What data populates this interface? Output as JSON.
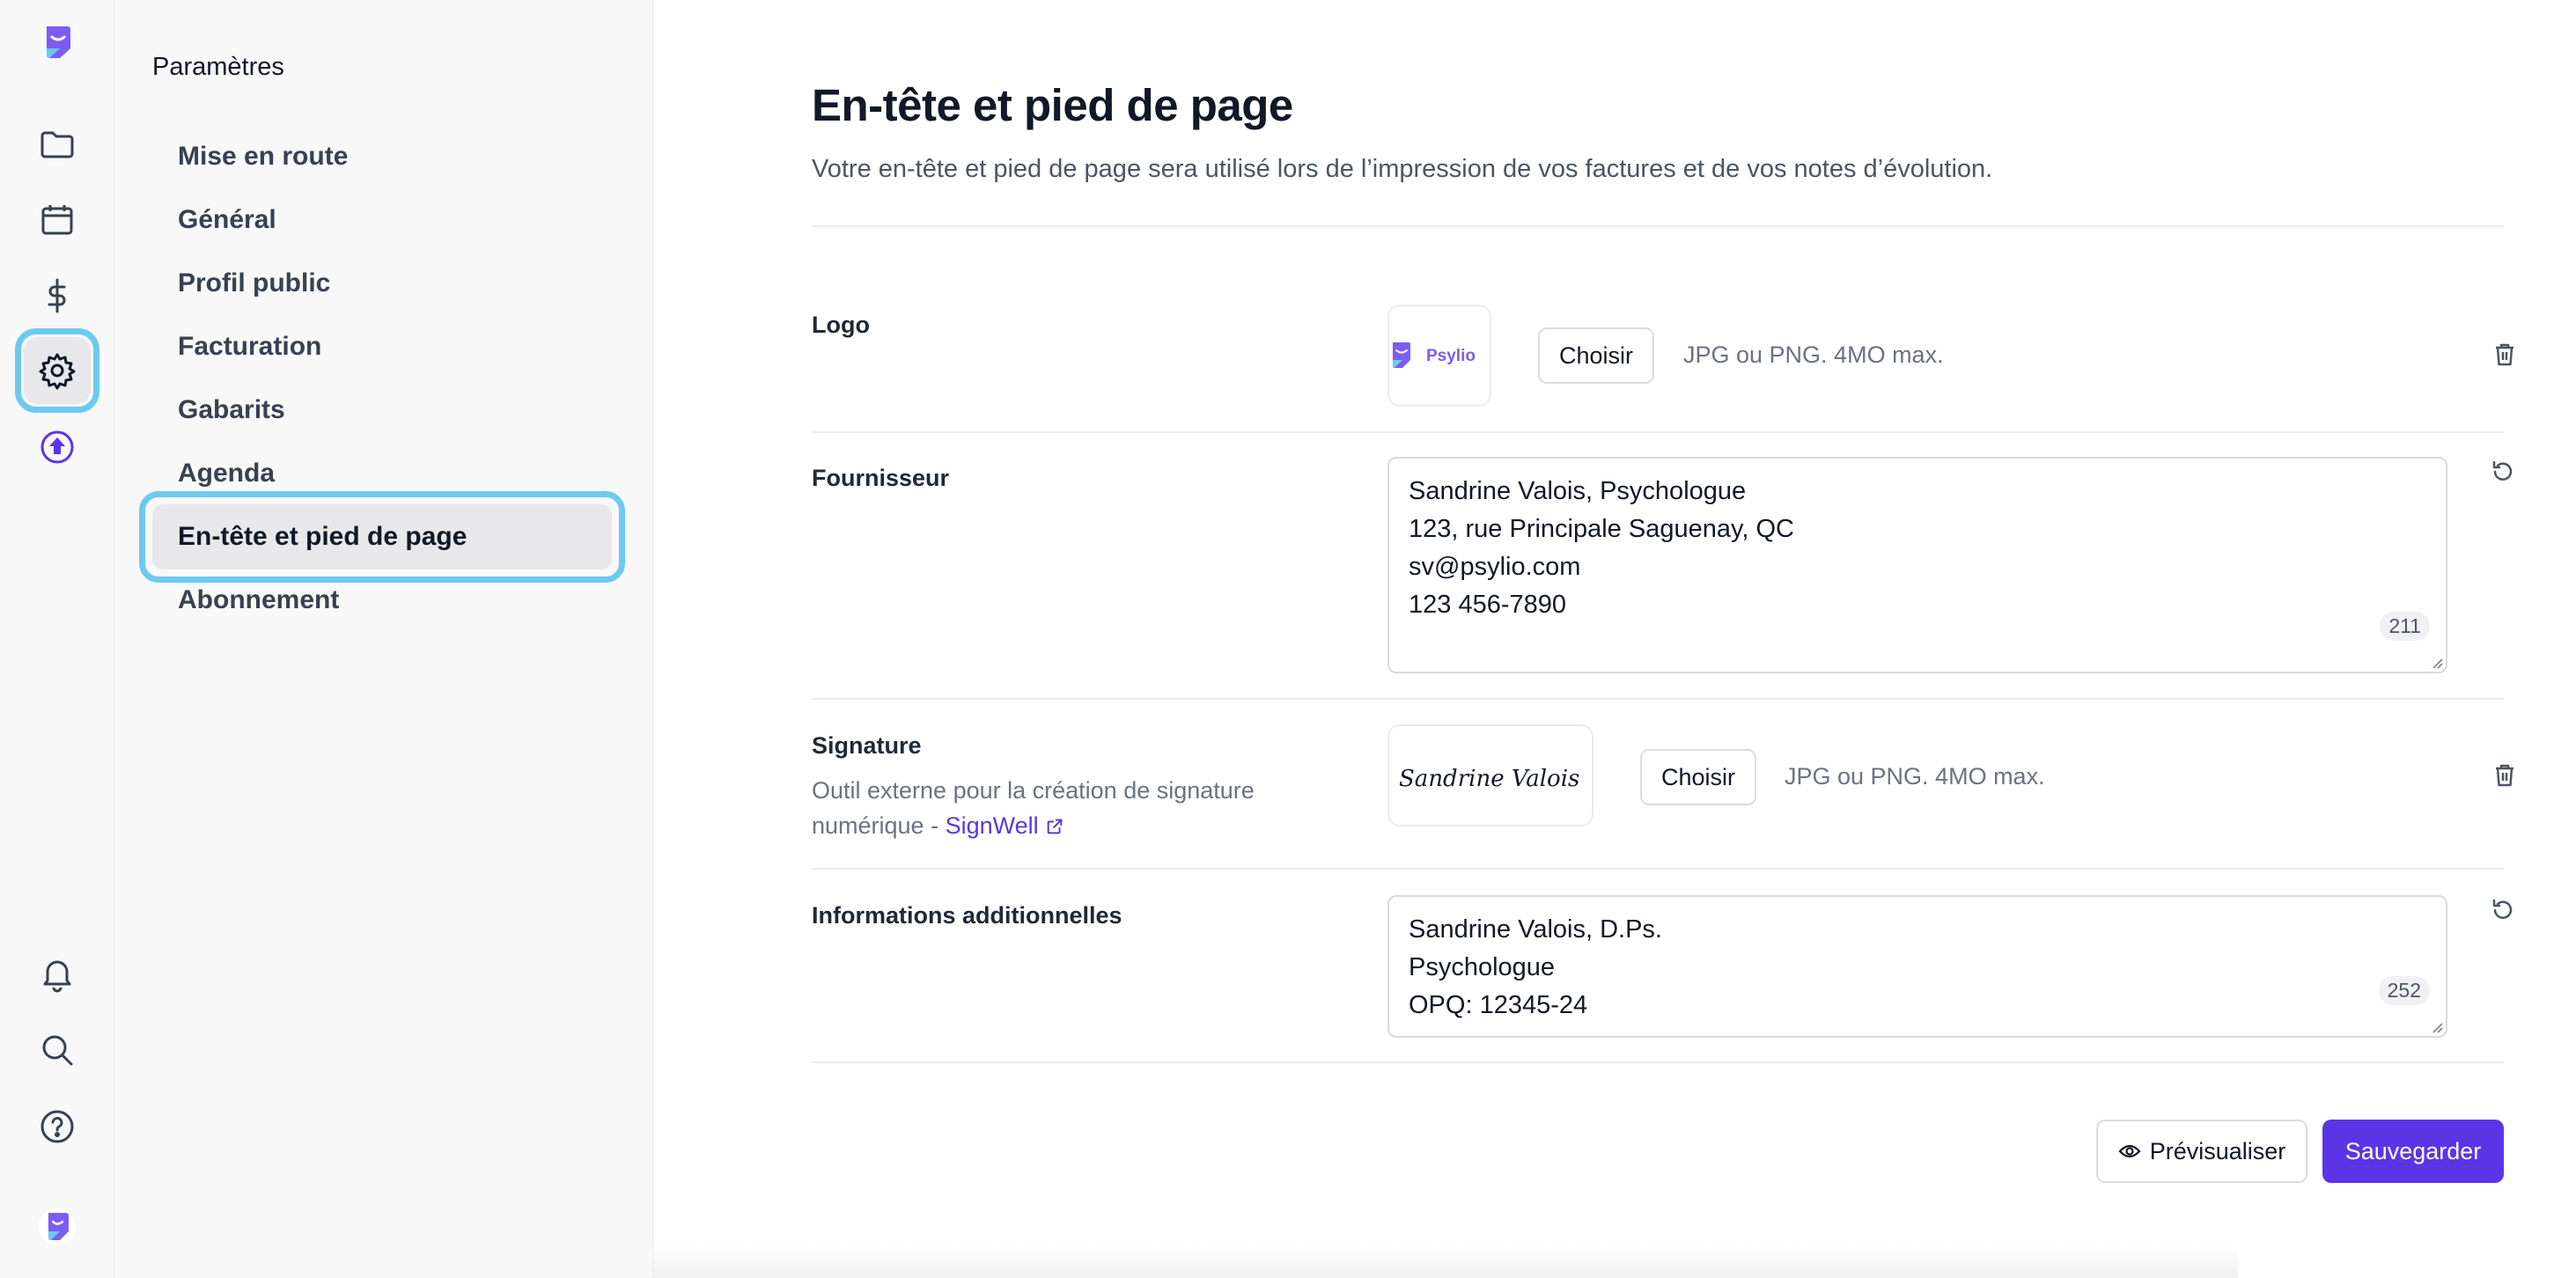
{
  "colors": {
    "accent": "#5b34e6",
    "highlight": "#6ccaf0",
    "brand_purple": "#7c5cf5"
  },
  "rail": {
    "items": [
      {
        "name": "app-logo",
        "icon": "psylio-logo"
      },
      {
        "name": "folder",
        "icon": "folder-icon"
      },
      {
        "name": "calendar",
        "icon": "calendar-icon"
      },
      {
        "name": "billing",
        "icon": "dollar-icon"
      },
      {
        "name": "settings",
        "icon": "gear-icon",
        "active": true
      },
      {
        "name": "upgrade",
        "icon": "arrow-up-circle-icon"
      },
      {
        "name": "notifications",
        "icon": "bell-icon"
      },
      {
        "name": "search",
        "icon": "search-icon"
      },
      {
        "name": "help",
        "icon": "help-icon"
      },
      {
        "name": "profile",
        "icon": "psylio-avatar"
      }
    ]
  },
  "subnav": {
    "title": "Paramètres",
    "items": [
      {
        "label": "Mise en route"
      },
      {
        "label": "Général"
      },
      {
        "label": "Profil public"
      },
      {
        "label": "Facturation"
      },
      {
        "label": "Gabarits"
      },
      {
        "label": "Agenda"
      },
      {
        "label": "En-tête et pied de page",
        "active": true
      },
      {
        "label": "Abonnement"
      }
    ]
  },
  "main": {
    "title": "En-tête et pied de page",
    "subtitle": "Votre en-tête et pied de page sera utilisé lors de l’impression de vos factures et de vos notes d’évolution.",
    "logo": {
      "label": "Logo",
      "preview_text": "Psylio",
      "choose_label": "Choisir",
      "hint": "JPG ou PNG. 4MO max."
    },
    "supplier": {
      "label": "Fournisseur",
      "lines": [
        "Sandrine Valois, Psychologue",
        "123, rue Principale Saguenay, QC",
        "sv@psylio.com",
        "123 456-7890"
      ],
      "counter": "211"
    },
    "signature": {
      "label": "Signature",
      "help_prefix": "Outil externe pour la création de signature numérique -",
      "help_link": "SignWell",
      "preview_text": "Sandrine Valois",
      "choose_label": "Choisir",
      "hint": "JPG ou PNG. 4MO max."
    },
    "additional": {
      "label": "Informations additionnelles",
      "lines": [
        "Sandrine Valois, D.Ps.",
        "Psychologue",
        "OPQ: 12345-24"
      ],
      "counter": "252"
    },
    "actions": {
      "preview_label": "Prévisualiser",
      "save_label": "Sauvegarder"
    }
  }
}
